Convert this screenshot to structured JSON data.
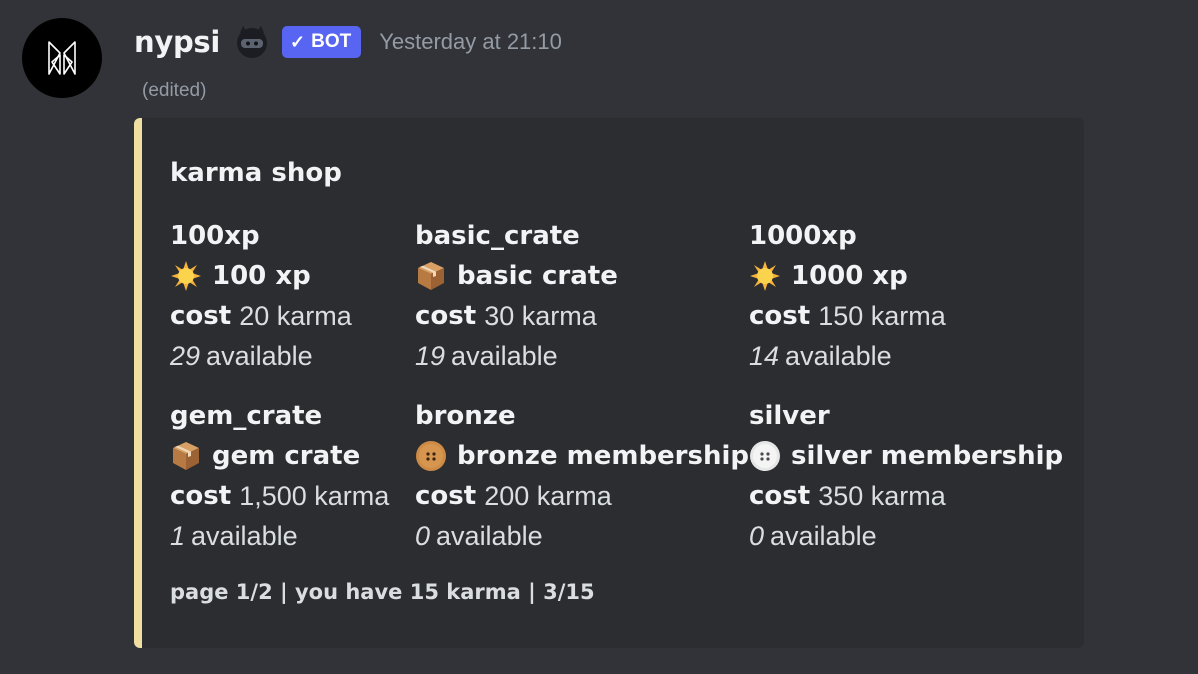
{
  "message": {
    "author": "nypsi",
    "bot_tag": "BOT",
    "bot_check": "✓",
    "timestamp": "Yesterday at 21:10",
    "edited": "(edited)"
  },
  "colors": {
    "embed_accent": "#f1dfa2",
    "bot_tag": "#5865f2",
    "background": "#313338",
    "embed_background": "#2b2d31"
  },
  "embed": {
    "title": "karma shop",
    "footer": "page 1/2 | you have 15 karma | 3/15",
    "cost_label": "cost",
    "available_label": "available",
    "items": [
      {
        "id": "100xp",
        "icon": "sun-icon",
        "name": "100 xp",
        "cost": "20 karma",
        "available": "29"
      },
      {
        "id": "basic_crate",
        "icon": "package-icon",
        "name": "basic crate",
        "cost": "30 karma",
        "available": "19"
      },
      {
        "id": "1000xp",
        "icon": "sun-icon",
        "name": "1000 xp",
        "cost": "150 karma",
        "available": "14"
      },
      {
        "id": "gem_crate",
        "icon": "package-icon",
        "name": "gem crate",
        "cost": "1,500 karma",
        "available": "1"
      },
      {
        "id": "bronze",
        "icon": "bronze-coin-icon",
        "name": "bronze membership",
        "cost": "200 karma",
        "available": "0"
      },
      {
        "id": "silver",
        "icon": "silver-coin-icon",
        "name": "silver membership",
        "cost": "350 karma",
        "available": "0"
      }
    ]
  }
}
